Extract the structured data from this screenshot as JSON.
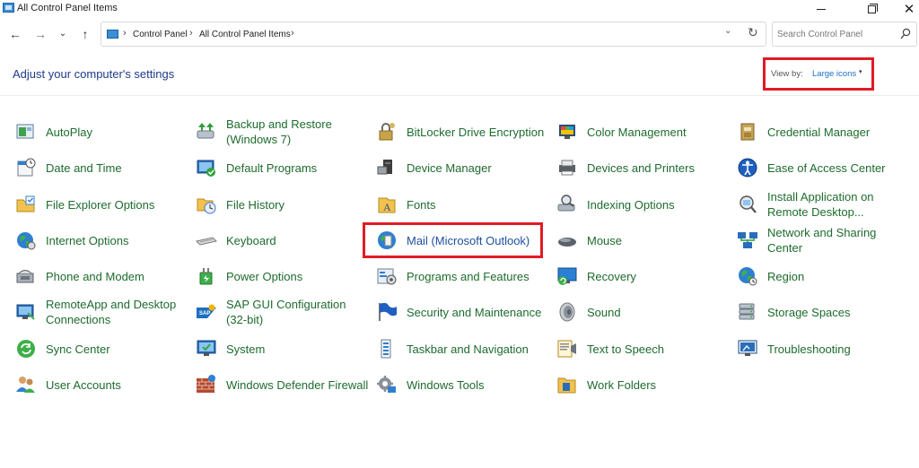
{
  "window": {
    "title": "All Control Panel Items",
    "minimize_glyph": "—",
    "maximize_glyph": "❐",
    "close_glyph": "✕"
  },
  "nav": {
    "back_glyph": "←",
    "forward_glyph": "→",
    "recent_glyph": "⌄",
    "up_glyph": "↑"
  },
  "address": {
    "sep_glyph": "›",
    "crumbs": [
      "Control Panel",
      "All Control Panel Items"
    ],
    "dropdown_glyph": "⌄",
    "refresh_glyph": "↻"
  },
  "search": {
    "placeholder": "Search Control Panel",
    "value": ""
  },
  "header": {
    "title": "Adjust your computer's settings",
    "view_by_label": "View by:",
    "view_by_value": "Large icons",
    "view_by_caret": "▾"
  },
  "items": [
    {
      "label": "AutoPlay",
      "icon": "autoplay-icon"
    },
    {
      "label": "Backup and Restore (Windows 7)",
      "icon": "backup-restore-icon"
    },
    {
      "label": "BitLocker Drive Encryption",
      "icon": "bitlocker-icon"
    },
    {
      "label": "Color Management",
      "icon": "color-management-icon"
    },
    {
      "label": "Credential Manager",
      "icon": "credential-manager-icon"
    },
    {
      "label": "Date and Time",
      "icon": "date-time-icon"
    },
    {
      "label": "Default Programs",
      "icon": "default-programs-icon"
    },
    {
      "label": "Device Manager",
      "icon": "device-manager-icon"
    },
    {
      "label": "Devices and Printers",
      "icon": "devices-printers-icon"
    },
    {
      "label": "Ease of Access Center",
      "icon": "ease-of-access-icon"
    },
    {
      "label": "File Explorer Options",
      "icon": "file-explorer-options-icon"
    },
    {
      "label": "File History",
      "icon": "file-history-icon"
    },
    {
      "label": "Fonts",
      "icon": "fonts-icon"
    },
    {
      "label": "Indexing Options",
      "icon": "indexing-options-icon"
    },
    {
      "label": "Install Application on Remote Desktop...",
      "icon": "install-application-icon"
    },
    {
      "label": "Internet Options",
      "icon": "internet-options-icon"
    },
    {
      "label": "Keyboard",
      "icon": "keyboard-icon"
    },
    {
      "label": "Mail (Microsoft Outlook)",
      "icon": "mail-icon"
    },
    {
      "label": "Mouse",
      "icon": "mouse-icon"
    },
    {
      "label": "Network and Sharing Center",
      "icon": "network-sharing-icon"
    },
    {
      "label": "Phone and Modem",
      "icon": "phone-modem-icon"
    },
    {
      "label": "Power Options",
      "icon": "power-options-icon"
    },
    {
      "label": "Programs and Features",
      "icon": "programs-features-icon"
    },
    {
      "label": "Recovery",
      "icon": "recovery-icon"
    },
    {
      "label": "Region",
      "icon": "region-icon"
    },
    {
      "label": "RemoteApp and Desktop Connections",
      "icon": "remoteapp-icon"
    },
    {
      "label": "SAP GUI Configuration (32-bit)",
      "icon": "sap-gui-icon"
    },
    {
      "label": "Security and Maintenance",
      "icon": "security-maintenance-icon"
    },
    {
      "label": "Sound",
      "icon": "sound-icon"
    },
    {
      "label": "Storage Spaces",
      "icon": "storage-spaces-icon"
    },
    {
      "label": "Sync Center",
      "icon": "sync-center-icon"
    },
    {
      "label": "System",
      "icon": "system-icon"
    },
    {
      "label": "Taskbar and Navigation",
      "icon": "taskbar-navigation-icon"
    },
    {
      "label": "Text to Speech",
      "icon": "text-to-speech-icon"
    },
    {
      "label": "Troubleshooting",
      "icon": "troubleshooting-icon"
    },
    {
      "label": "User Accounts",
      "icon": "user-accounts-icon"
    },
    {
      "label": "Windows Defender Firewall",
      "icon": "firewall-icon"
    },
    {
      "label": "Windows Tools",
      "icon": "windows-tools-icon"
    },
    {
      "label": "Work Folders",
      "icon": "work-folders-icon"
    }
  ],
  "colors": {
    "link_green": "#1e6b2e",
    "heading_blue": "#1e3a8a",
    "highlight_red": "#e01b24"
  }
}
